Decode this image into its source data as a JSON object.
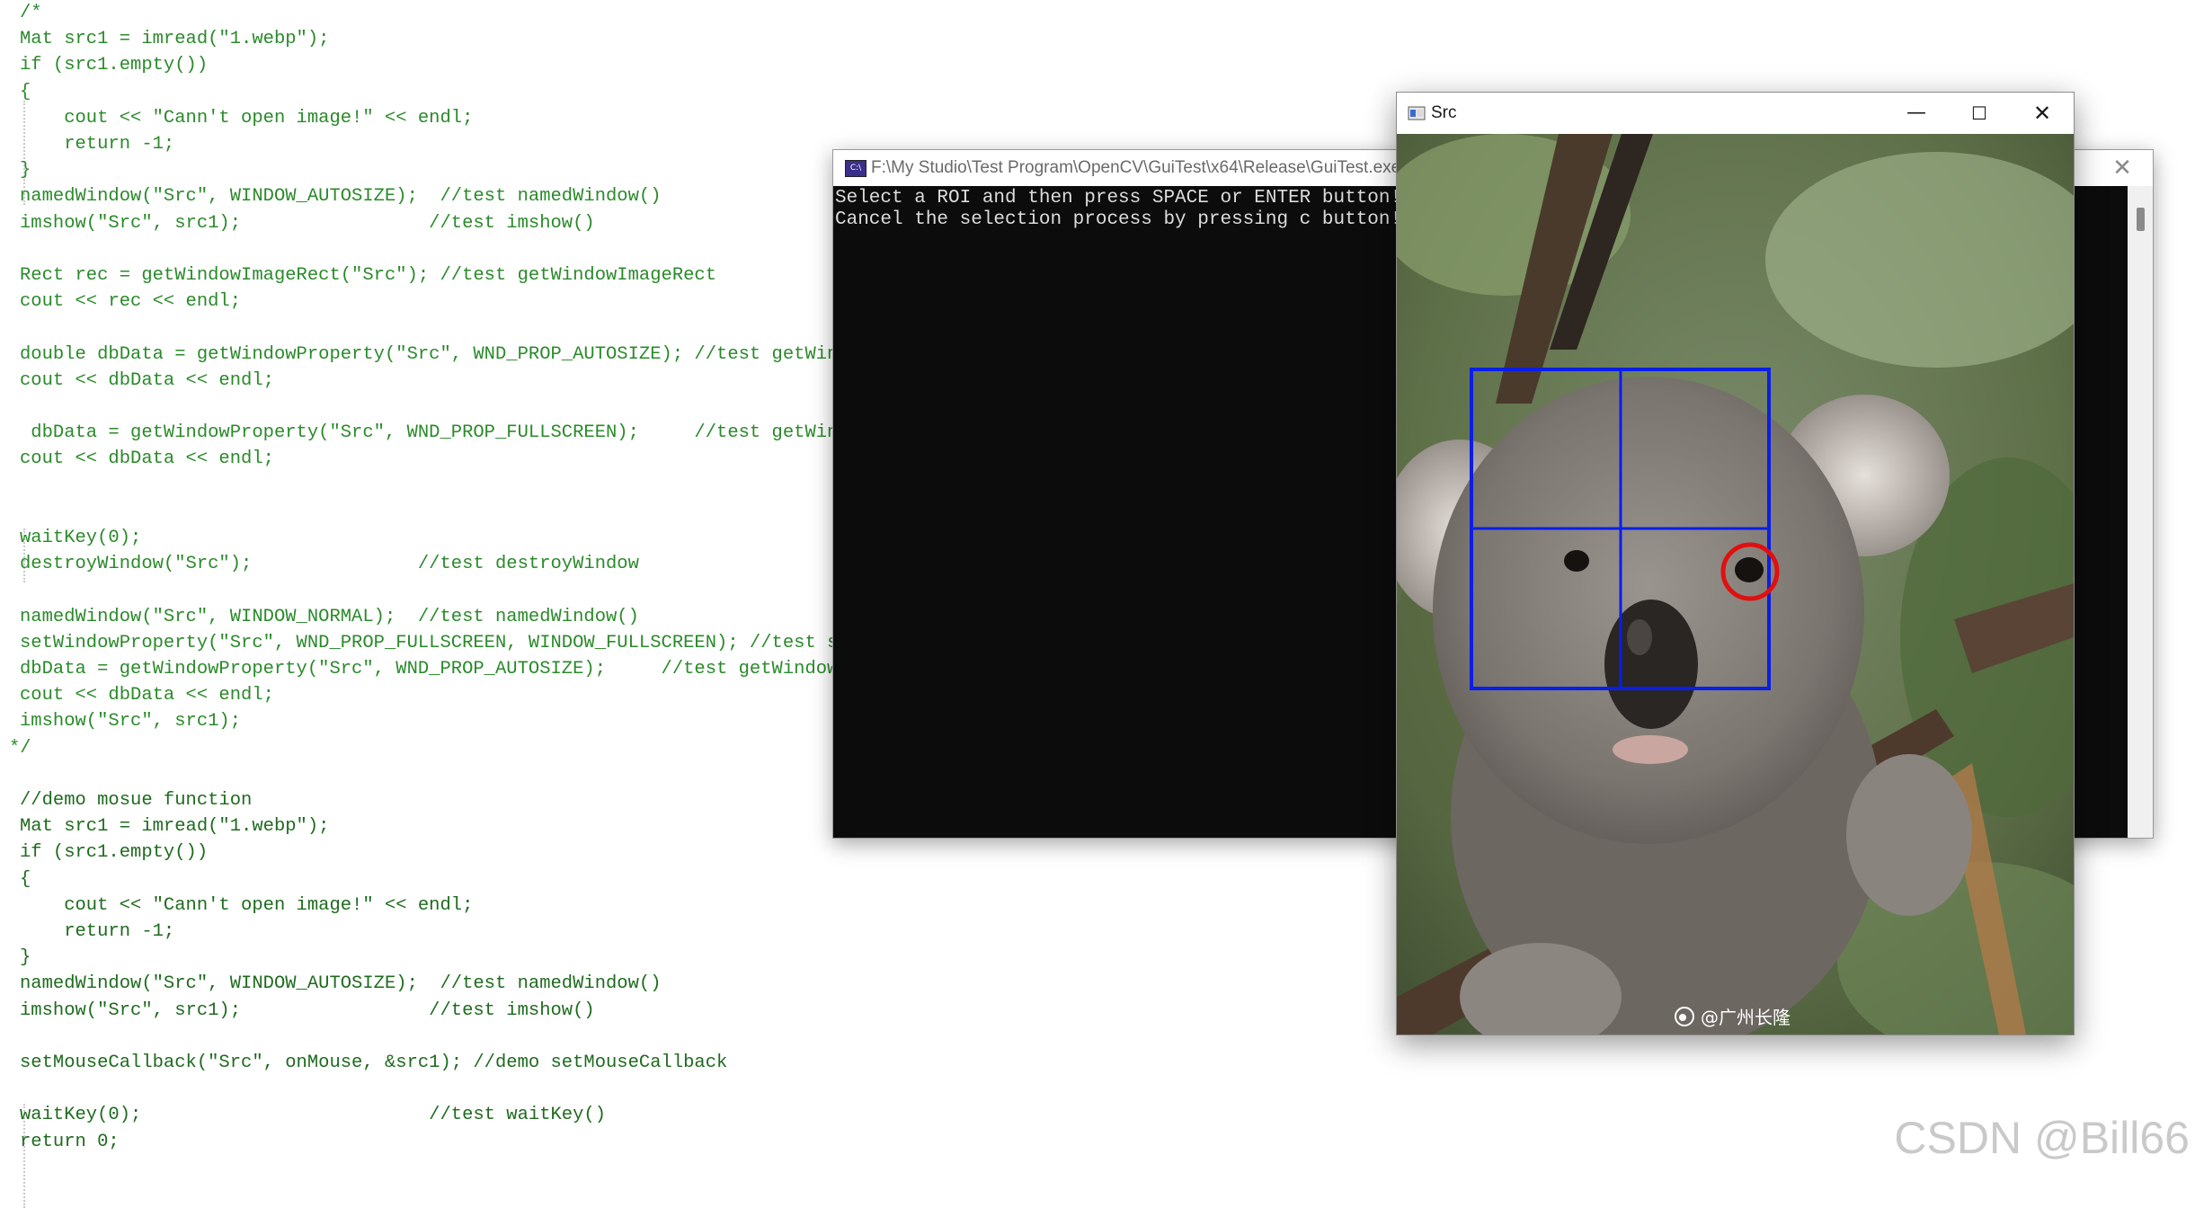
{
  "code_lines": [
    "/*",
    "Mat src1 = imread(\"1.webp\");",
    "if (src1.empty())",
    "{",
    "    cout << \"Cann't open image!\" << endl;",
    "    return -1;",
    "}",
    "namedWindow(\"Src\", WINDOW_AUTOSIZE);  //test namedWindow()",
    "imshow(\"Src\", src1);                 //test imshow()",
    "",
    "Rect rec = getWindowImageRect(\"Src\"); //test getWindowImageRect",
    "cout << rec << endl;",
    "",
    "double dbData = getWindowProperty(\"Src\", WND_PROP_AUTOSIZE); //test getWindow",
    "cout << dbData << endl;",
    "",
    " dbData = getWindowProperty(\"Src\", WND_PROP_FULLSCREEN);     //test getWindow",
    "cout << dbData << endl;",
    "",
    "",
    "waitKey(0);",
    "destroyWindow(\"Src\");               //test destroyWindow",
    "",
    "namedWindow(\"Src\", WINDOW_NORMAL);  //test namedWindow()",
    "setWindowProperty(\"Src\", WND_PROP_FULLSCREEN, WINDOW_FULLSCREEN); //test setW",
    "dbData = getWindowProperty(\"Src\", WND_PROP_AUTOSIZE);     //test getWindowPro",
    "cout << dbData << endl;",
    "imshow(\"Src\", src1);",
    "*/",
    "",
    "//demo mosue function",
    "Mat src1 = imread(\"1.webp\");",
    "if (src1.empty())",
    "{",
    "    cout << \"Cann't open image!\" << endl;",
    "    return -1;",
    "}",
    "namedWindow(\"Src\", WINDOW_AUTOSIZE);  //test namedWindow()",
    "imshow(\"Src\", src1);                 //test imshow()",
    "",
    "setMouseCallback(\"Src\", onMouse, &src1); //demo setMouseCallback",
    "",
    "waitKey(0);                          //test waitKey()",
    "return 0;"
  ],
  "console": {
    "title": "F:\\My Studio\\Test Program\\OpenCV\\GuiTest\\x64\\Release\\GuiTest.exe",
    "icon": "console-app-icon",
    "icon_text": "C:\\",
    "lines": [
      "Select a ROI and then press SPACE or ENTER button!",
      "Cancel the selection process by pressing c button!"
    ],
    "close_glyph": "✕"
  },
  "src_window": {
    "title": "Src",
    "minimize_glyph": "—",
    "maximize_glyph": "☐",
    "close_glyph": "✕",
    "image_watermark": "@广州长隆",
    "colors": {
      "roi_box": "#0a1ee6",
      "click_circle": "#e01010"
    }
  },
  "watermark": "CSDN @Bill66"
}
